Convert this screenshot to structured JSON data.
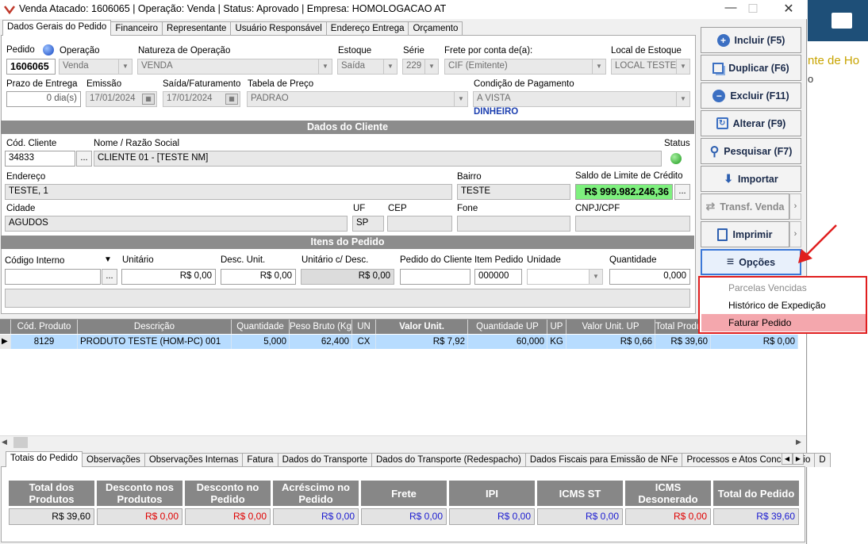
{
  "window": {
    "title": "Venda Atacado: 1606065 | Operação: Venda | Status: Aprovado | Empresa: HOMOLOGACAO AT",
    "min": "—",
    "max": "☐",
    "close": "✕"
  },
  "background_app": {
    "text1": "nte de Ho",
    "text2": "o"
  },
  "top_tabs": [
    "Dados Gerais do Pedido",
    "Financeiro",
    "Representante",
    "Usuário Responsável",
    "Endereço Entrega",
    "Orçamento"
  ],
  "form": {
    "pedido_label": "Pedido",
    "pedido": "1606065",
    "operacao_label": "Operação",
    "operacao": "Venda",
    "natureza_label": "Natureza de Operação",
    "natureza": "VENDA",
    "estoque_label": "Estoque",
    "estoque": "Saída",
    "serie_label": "Série",
    "serie": "229",
    "frete_label": "Frete por conta de(a):",
    "frete": "CIF (Emitente)",
    "local_label": "Local de Estoque",
    "local": "LOCAL TESTE",
    "prazo_label": "Prazo de Entrega",
    "prazo": "0 dia(s)",
    "emissao_label": "Emissão",
    "emissao": "17/01/2024",
    "saida_label": "Saída/Faturamento",
    "saida": "17/01/2024",
    "tabela_label": "Tabela de Preço",
    "tabela": "PADRAO",
    "condicao_label": "Condição de Pagamento",
    "condicao": "A VISTA",
    "forma": "DINHEIRO"
  },
  "cliente": {
    "section": "Dados do Cliente",
    "cod_label": "Cód. Cliente",
    "cod": "34833",
    "nome_label": "Nome / Razão Social",
    "nome": "CLIENTE 01 - [TESTE NM]",
    "status_label": "Status",
    "endereco_label": "Endereço",
    "endereco": "TESTE, 1",
    "bairro_label": "Bairro",
    "bairro": "TESTE",
    "saldo_label": "Saldo de Limite de Crédito",
    "saldo": "R$ 999.982.246,36",
    "cidade_label": "Cidade",
    "cidade": "AGUDOS",
    "uf_label": "UF",
    "uf": "SP",
    "cep_label": "CEP",
    "fone_label": "Fone",
    "cnpj_label": "CNPJ/CPF"
  },
  "itens": {
    "section": "Itens do Pedido",
    "codigo_label": "Código Interno",
    "unitario_label": "Unitário",
    "unitario": "R$ 0,00",
    "desc_label": "Desc. Unit.",
    "desc": "R$ 0,00",
    "unit_desc_label": "Unitário c/ Desc.",
    "unit_desc": "R$ 0,00",
    "ped_cliente_label": "Pedido do Cliente",
    "item_label": "Item Pedido",
    "item": "000000",
    "unidade_label": "Unidade",
    "qtd_label": "Quantidade",
    "qtd": "0,000"
  },
  "buttons": {
    "incluir": "Incluir (F5)",
    "duplicar": "Duplicar (F6)",
    "excluir": "Excluir (F11)",
    "alterar": "Alterar (F9)",
    "pesquisar": "Pesquisar (F7)",
    "importar": "Importar",
    "transf": "Transf. Venda",
    "imprimir": "Imprimir",
    "opcoes": "Opções"
  },
  "menu": [
    "Parcelas Vencidas",
    "Histórico de Expedição",
    "Faturar Pedido"
  ],
  "grid": {
    "headers": [
      "Cód. Produto",
      "Descrição",
      "Quantidade",
      "Peso Bruto (Kg)",
      "UN",
      "Valor Unit.",
      "Quantidade UP",
      "UP",
      "Valor Unit. UP",
      "Total Produ"
    ],
    "row": [
      "8129",
      "PRODUTO TESTE (HOM-PC) 001",
      "5,000",
      "62,400",
      "CX",
      "R$ 7,92",
      "60,000",
      "KG",
      "R$ 0,66",
      "R$ 39,60",
      "R$ 0,00"
    ]
  },
  "bottom_tabs": [
    "Totais do Pedido",
    "Observações",
    "Observações Internas",
    "Fatura",
    "Dados do Transporte",
    "Dados do Transporte (Redespacho)",
    "Dados Fiscais para Emissão de NFe",
    "Processos e Atos Concessório",
    "D"
  ],
  "totals": [
    {
      "label": "Total dos Produtos",
      "value": "R$ 39,60",
      "color": "#000000"
    },
    {
      "label": "Desconto nos Produtos",
      "value": "R$ 0,00",
      "color": "#e00000"
    },
    {
      "label": "Desconto no Pedido",
      "value": "R$ 0,00",
      "color": "#e00000"
    },
    {
      "label": "Acréscimo no Pedido",
      "value": "R$ 0,00",
      "color": "#1a1ad0"
    },
    {
      "label": "Frete",
      "value": "R$ 0,00",
      "color": "#1a1ad0"
    },
    {
      "label": "IPI",
      "value": "R$ 0,00",
      "color": "#1a1ad0"
    },
    {
      "label": "ICMS ST",
      "value": "R$ 0,00",
      "color": "#1a1ad0"
    },
    {
      "label": "ICMS Desonerado",
      "value": "R$ 0,00",
      "color": "#e00000"
    },
    {
      "label": "Total do Pedido",
      "value": "R$ 39,60",
      "color": "#1a1ad0"
    }
  ]
}
